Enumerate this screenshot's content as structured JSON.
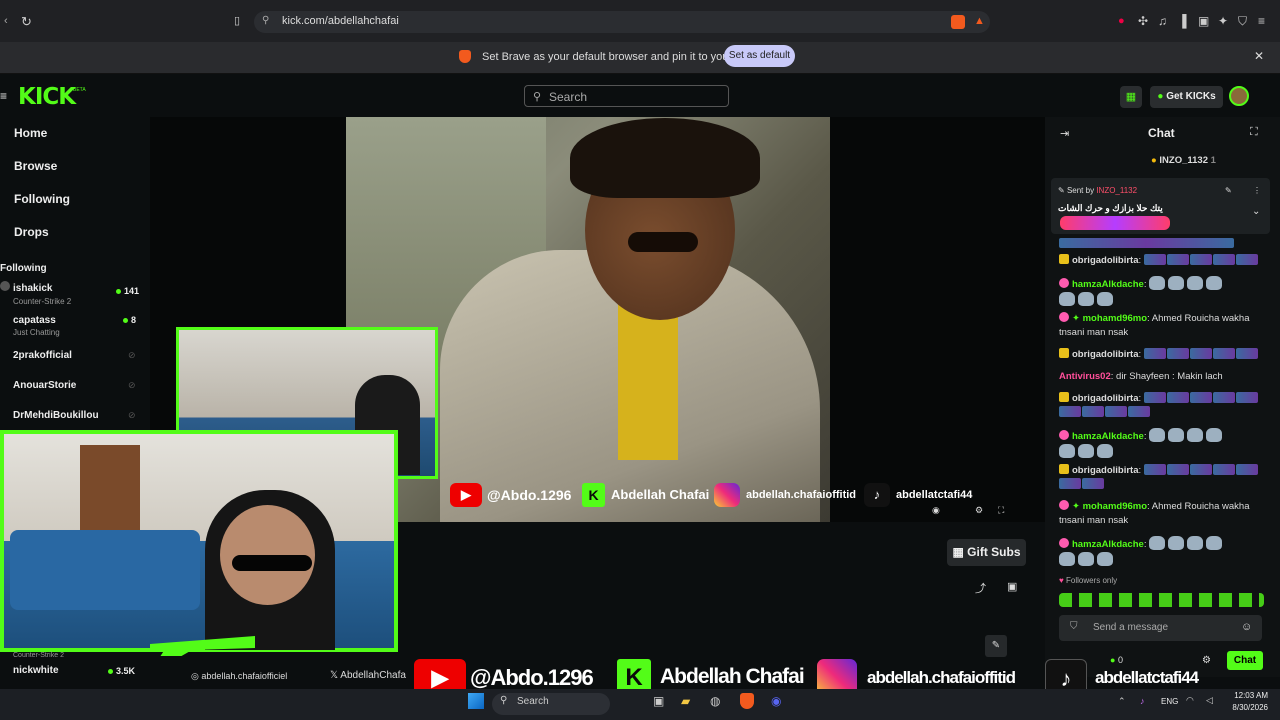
{
  "browser": {
    "url": "kick.com/abdellahchafai",
    "infobar_text": "Set Brave as your default browser and pin it to your taskbar",
    "set_default_label": "Set as default"
  },
  "header": {
    "logo": "KICK",
    "logo_tag": "BETA",
    "search_placeholder": "Search",
    "get_kicks_label": "Get KICKs"
  },
  "sidebar": {
    "nav": [
      "Home",
      "Browse",
      "Following",
      "Drops"
    ],
    "following_heading": "Following",
    "channels": [
      {
        "name": "ishakick",
        "sub": "Counter-Strike 2",
        "count": "141"
      },
      {
        "name": "capatass",
        "sub": "Just Chatting",
        "count": "8"
      },
      {
        "name": "2prakofficial",
        "sub": "",
        "count": ""
      },
      {
        "name": "AnouarStorie",
        "sub": "",
        "count": ""
      },
      {
        "name": "DrMehdiBoukillou",
        "sub": "",
        "count": ""
      }
    ],
    "bottom_channel": {
      "name": "nickwhite",
      "sub": "Counter-Strike 2",
      "count": "3.5K"
    }
  },
  "overlay": {
    "youtube": "@Abdo.1296",
    "kick": "Abdellah Chafai",
    "instagram": "abdellah.chafaioffitid",
    "tiktok": "abdellatctafi44",
    "small_ig": "abdellah.chafaiofficiel",
    "small_x": "AbdellahChafa"
  },
  "below_video": {
    "gift_subs_label": "Gift Subs"
  },
  "chat": {
    "title": "Chat",
    "top_user": "INZO_1132",
    "top_user_count": "1",
    "pinned_sent_by": "Sent by",
    "pinned_user": "INZO_1132",
    "pinned_text": "يتك حلا بزازك و حرك الشات",
    "messages": [
      {
        "user": "obrigadolibirta",
        "color": "#e8e8e8",
        "text": "",
        "type": "emotes"
      },
      {
        "user": "hamzaAlkdache",
        "color": "#f0f0f0",
        "text": "",
        "type": "seals"
      },
      {
        "user": "mohamd96mo",
        "color": "#f0f0f0",
        "text": "Ahmed Rouicha wakha tnsani man nsak",
        "type": "text"
      },
      {
        "user": "obrigadolibirta",
        "color": "#e8e8e8",
        "text": "",
        "type": "emotes"
      },
      {
        "user": "Antivirus02",
        "color": "#ff4f9a",
        "text": "dir Shayfeen : Makin lach",
        "type": "text"
      },
      {
        "user": "obrigadolibirta",
        "color": "#e8e8e8",
        "text": "",
        "type": "emotes"
      },
      {
        "user": "hamzaAlkdache",
        "color": "#f0f0f0",
        "text": "",
        "type": "seals"
      },
      {
        "user": "obrigadolibirta",
        "color": "#e8e8e8",
        "text": "",
        "type": "emotes"
      },
      {
        "user": "mohamd96mo",
        "color": "#f0f0f0",
        "text": "Ahmed Rouicha wakha tnsani man nsak",
        "type": "text"
      },
      {
        "user": "hamzaAlkdache",
        "color": "#f0f0f0",
        "text": "",
        "type": "seals"
      }
    ],
    "followers_only": "Followers only",
    "input_placeholder": "Send a message",
    "kicks_count": "0",
    "chat_button": "Chat"
  },
  "taskbar": {
    "search_label": "Search",
    "language": "ENG",
    "time": "12:03 AM",
    "date": "8/30/2026"
  },
  "colors": {
    "accent": "#53fc18",
    "background": "#0b0e0f",
    "chat_bg": "#0f1213"
  }
}
